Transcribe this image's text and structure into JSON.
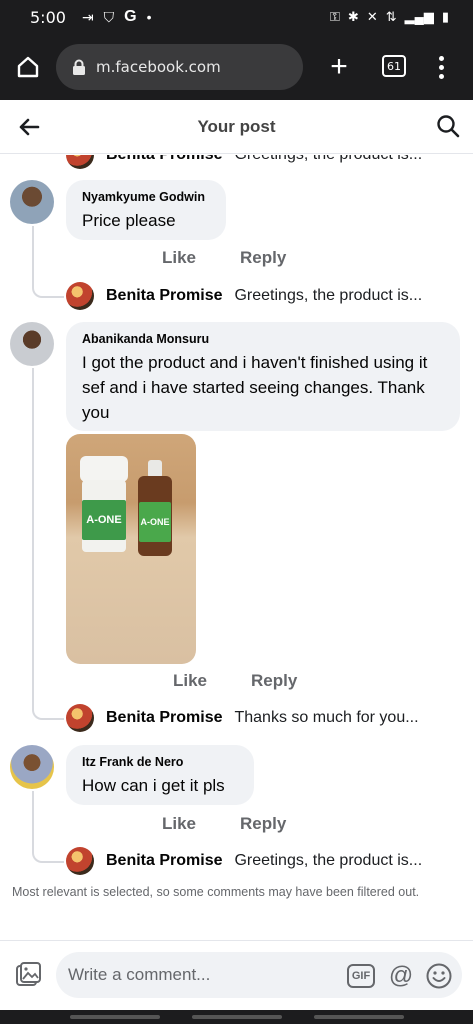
{
  "status_bar": {
    "time": "5:00",
    "left_icons": [
      "key-icon",
      "shield-icon",
      "google-icon",
      "dot-icon"
    ],
    "right_icons": [
      "vpn-key-icon",
      "bluetooth-icon",
      "mute-icon",
      "data-icon",
      "signal-icon",
      "battery-icon"
    ]
  },
  "browser": {
    "url": "m.facebook.com",
    "tab_count": "61"
  },
  "header": {
    "title": "Your post"
  },
  "thread": {
    "partial_reply": {
      "name": "Benita Promise",
      "text": "Greetings, the product is..."
    },
    "comments": [
      {
        "author": "Nyamkyume Godwin",
        "text": "Price please",
        "like_label": "Like",
        "reply_label": "Reply",
        "reply": {
          "name": "Benita Promise",
          "text": "Greetings, the product is..."
        }
      },
      {
        "author": "Abanikanda Monsuru",
        "text": "I got the product and i haven't finished using it sef and i have started seeing changes. Thank you",
        "like_label": "Like",
        "reply_label": "Reply",
        "reply": {
          "name": "Benita Promise",
          "text": "Thanks so much for you..."
        }
      },
      {
        "author": "Itz Frank de Nero",
        "text": "How can i get it pls",
        "like_label": "Like",
        "reply_label": "Reply",
        "reply": {
          "name": "Benita Promise",
          "text": "Greetings, the product is..."
        }
      }
    ],
    "photo": {
      "bottle_label_1": "A-ONE",
      "bottle_label_2": "A-ONE"
    }
  },
  "filter_note": "Most relevant is selected, so some comments may have been filtered out.",
  "composer": {
    "placeholder": "Write a comment...",
    "gif_label": "GIF",
    "at_label": "@"
  },
  "colors": {
    "bubble": "#f0f2f5",
    "secondary_text": "#65676b",
    "chrome_bg": "#1c1c1e"
  }
}
